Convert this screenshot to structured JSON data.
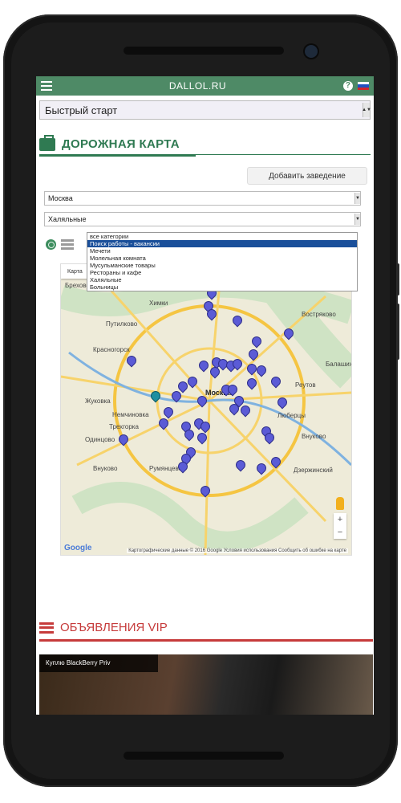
{
  "app": {
    "brand": "DALLOL.RU",
    "help_glyph": "?"
  },
  "quick_start": {
    "value": "Быстрый старт"
  },
  "section_map": {
    "title": "ДОРОЖНАЯ КАРТА",
    "color": "#2f7a52"
  },
  "add_button": {
    "label": "Добавить заведение"
  },
  "city_select": {
    "value": "Москва"
  },
  "category_select": {
    "value": "Халяльные",
    "options": [
      "все категории",
      "Поиск работы - вакансии",
      "Мечети",
      "Молельная комната",
      "Мусульманские товары",
      "Рестораны и кафе",
      "Халяльные",
      "Больницы"
    ],
    "highlighted_index": 1
  },
  "map": {
    "tab_label": "Карта",
    "labels": [
      "Химки",
      "Красногорск",
      "Одинцово",
      "Москва",
      "Люберцы",
      "Реутов",
      "Внуково",
      "Дзержинский",
      "Балашиха",
      "Трехгорка",
      "Жуковка",
      "Путилково",
      "Брехово",
      "Немчиновка",
      "Румянцево",
      "Востряково"
    ],
    "copyright": "Картографические данные © 2016 Google   Условия использования   Сообщить об ошибке на карте",
    "google_logo": "Google",
    "zoom_in": "+",
    "zoom_out": "−"
  },
  "section_vip": {
    "title": "ОБЪЯВЛЕНИЯ VIP",
    "color": "#c63b3b"
  },
  "vip_card": {
    "caption": "Куплю BlackBerry Priv"
  },
  "colors": {
    "topbar": "#4e8a66",
    "accent_green": "#2f7a52",
    "accent_red": "#c63b3b",
    "pin": "#5b5bd6",
    "dropdown_highlight": "#1a4f9a"
  }
}
